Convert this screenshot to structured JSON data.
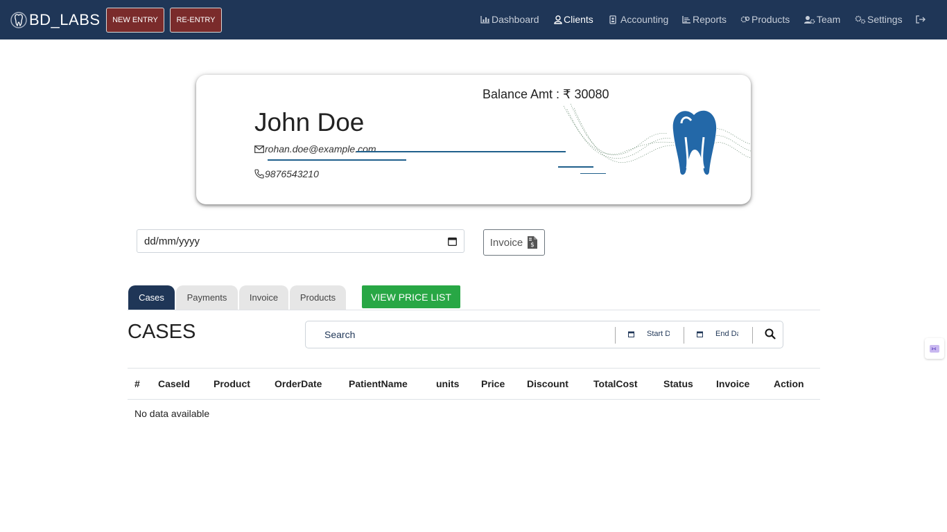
{
  "brand": {
    "name": "BD_LABS",
    "icon": "tooth-logo-icon"
  },
  "header": {
    "new_entry": "NEW ENTRY",
    "re_entry": "RE-ENTRY"
  },
  "nav": {
    "dashboard": "Dashboard",
    "clients": "Clients",
    "accounting": "Accounting",
    "reports": "Reports",
    "products": "Products",
    "team": "Team",
    "settings": "Settings"
  },
  "client": {
    "balance": "Balance Amt : ₹ 30080",
    "name": "John Doe",
    "email": "rohan.doe@example.com",
    "phone": "9876543210"
  },
  "filters": {
    "date_value": "dd/mm/yyyy",
    "invoice_label": "Invoice"
  },
  "tabs": {
    "cases": "Cases",
    "payments": "Payments",
    "invoice": "Invoice",
    "products": "Products"
  },
  "price_list_label": "VIEW PRICE LIST",
  "section": {
    "title": "CASES",
    "search_placeholder": "Search",
    "start_date_placeholder": "Start Date",
    "end_date_placeholder": "End Date"
  },
  "table": {
    "headers": [
      "#",
      "CaseId",
      "Product",
      "OrderDate",
      "PatientName",
      "units",
      "Price",
      "Discount",
      "TotalCost",
      "Status",
      "Invoice",
      "Action"
    ],
    "empty_message": "No data available"
  },
  "colors": {
    "navbar": "#1f3657",
    "entry_button": "#7a2b2b",
    "price_button": "#28a745",
    "accent_line": "#1f5f8b"
  }
}
